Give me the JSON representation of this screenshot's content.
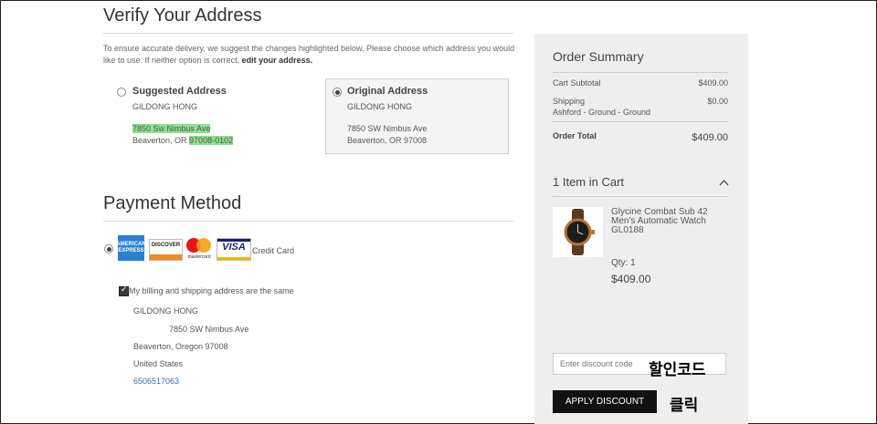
{
  "verify": {
    "title": "Verify Your Address",
    "intro_text": "To ensure accurate delivery, we suggest the changes highlighted below. Please choose which address you would like to use. If neither option is correct,",
    "edit_link": "edit your address.",
    "suggested": {
      "label": "Suggested Address",
      "name": "GILDONG HONG",
      "street": "7850 Sw Nimbus Ave",
      "city_state": "Beaverton, OR",
      "zip": "97008-0102"
    },
    "original": {
      "label": "Original Address",
      "name": "GILDONG HONG",
      "street": "7850 SW Nimbus Ave",
      "city_state_zip": "Beaverton, OR 97008"
    }
  },
  "payment": {
    "title": "Payment Method",
    "card_icons": [
      "amex-icon",
      "discover-icon",
      "mastercard-icon",
      "visa-icon"
    ],
    "amex_text": "AMERICAN EXPRESS",
    "discover_text": "DISCOVER",
    "mastercard_text": "mastercard",
    "visa_text": "VISA",
    "credit_card_label": "Credit Card",
    "same_address_label": "My billing and shipping address are the same",
    "billing": {
      "name": "GILDONG HONG",
      "street": "7850 SW Nimbus Ave",
      "city": "Beaverton, Oregon 97008",
      "country": "United States",
      "phone": "6506517063"
    }
  },
  "summary": {
    "title": "Order Summary",
    "cart_subtotal_label": "Cart Subtotal",
    "cart_subtotal_value": "$409.00",
    "shipping_label": "Shipping",
    "shipping_method": "Ashford - Ground - Ground",
    "shipping_value": "$0.00",
    "order_total_label": "Order Total",
    "order_total_value": "$409.00",
    "items_title": "1 Item in Cart",
    "item": {
      "name_line1": "Glycine Combat Sub 42",
      "name_line2": "Men's Automatic Watch",
      "name_line3": "GL0188",
      "qty": "Qty: 1",
      "price": "$409.00"
    },
    "discount_placeholder": "Enter discount code",
    "apply_label": "APPLY DISCOUNT"
  },
  "annotations": {
    "discount_code_note": "할인코드",
    "click_note": "클릭"
  },
  "colors": {
    "highlight": "#8de28d",
    "button_bg": "#111111",
    "panel_bg": "#eeeeee",
    "link": "#2d6fb0"
  }
}
